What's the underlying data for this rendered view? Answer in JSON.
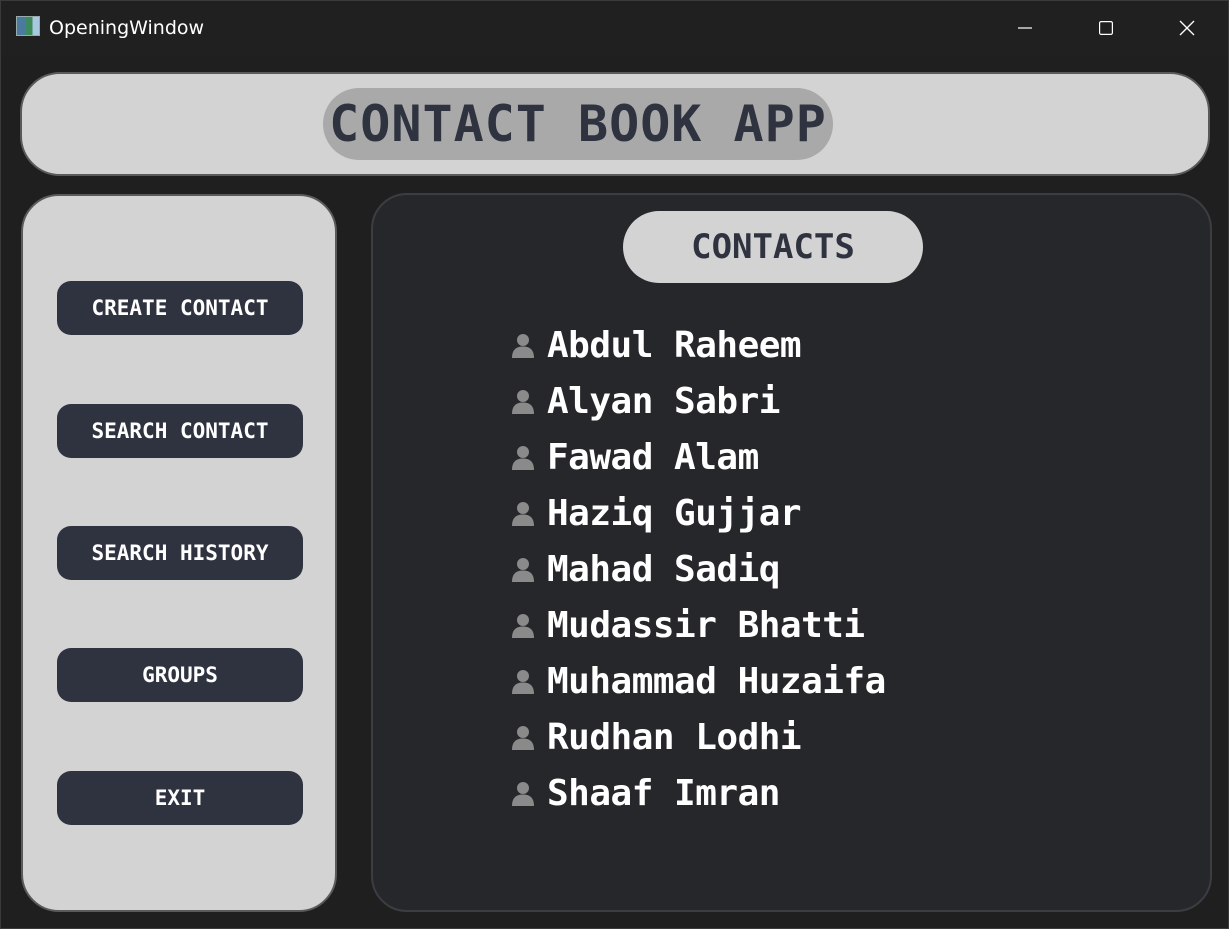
{
  "window": {
    "title": "OpeningWindow"
  },
  "header": {
    "title": "CONTACT BOOK APP"
  },
  "sidebar": {
    "buttons": [
      {
        "label": "CREATE CONTACT"
      },
      {
        "label": "SEARCH CONTACT"
      },
      {
        "label": "SEARCH HISTORY"
      },
      {
        "label": "GROUPS"
      },
      {
        "label": "EXIT"
      }
    ]
  },
  "main": {
    "title": "CONTACTS",
    "contacts": [
      {
        "name": "Abdul Raheem",
        "icon": "person-icon"
      },
      {
        "name": "Alyan Sabri",
        "icon": "person-icon"
      },
      {
        "name": "Fawad Alam",
        "icon": "person-icon"
      },
      {
        "name": "Haziq Gujjar",
        "icon": "person-icon"
      },
      {
        "name": "Mahad Sadiq",
        "icon": "person-icon"
      },
      {
        "name": "Mudassir Bhatti",
        "icon": "person-icon"
      },
      {
        "name": "Muhammad Huzaifa",
        "icon": "person-icon"
      },
      {
        "name": "Rudhan Lodhi",
        "icon": "person-icon"
      },
      {
        "name": "Shaaf Imran",
        "icon": "person-icon"
      }
    ]
  },
  "colors": {
    "background": "#1f1f1f",
    "panel_light": "#d3d3d3",
    "header_pill": "#a9a9a9",
    "button_dark": "#2f3340",
    "main_panel": "#26272b",
    "text_light": "#ffffff",
    "icon_gray": "#8a8a8a"
  }
}
